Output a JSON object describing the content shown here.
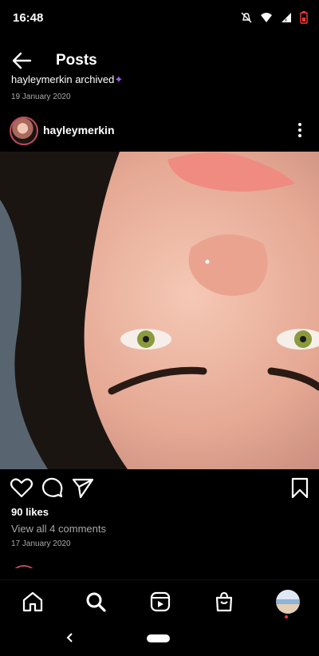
{
  "status_bar": {
    "time": "16:48"
  },
  "header": {
    "title": "Posts"
  },
  "previous_post": {
    "caption": "hayleymerkin archived",
    "date": "19 January 2020"
  },
  "post": {
    "username": "hayleymerkin",
    "likes": "90 likes",
    "comments_link": "View all 4 comments",
    "date": "17 January 2020"
  },
  "icons": {
    "back": "arrow-left-icon",
    "more": "more-vertical-icon",
    "like": "heart-icon",
    "comment": "comment-icon",
    "share": "send-icon",
    "save": "bookmark-icon",
    "home": "home-icon",
    "search": "search-icon",
    "reels": "reels-icon",
    "shop": "shop-icon",
    "profile": "profile-avatar"
  },
  "colors": {
    "background": "#000000",
    "accent": "#c14a62",
    "muted": "#a8a8a8",
    "notification_dot": "#ff3040"
  }
}
